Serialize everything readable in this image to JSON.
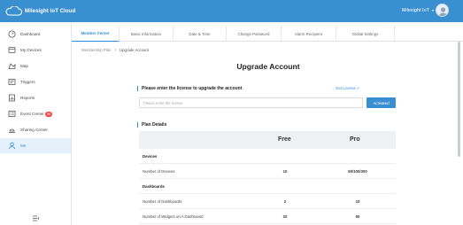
{
  "app": {
    "title": "Milesight IoT Cloud"
  },
  "user": {
    "name": "Milesight IoT"
  },
  "sidebar": {
    "items": [
      {
        "label": "Dashboard",
        "icon": "dashboard-icon"
      },
      {
        "label": "My Devices",
        "icon": "devices-icon"
      },
      {
        "label": "Map",
        "icon": "map-icon"
      },
      {
        "label": "Triggers",
        "icon": "triggers-icon"
      },
      {
        "label": "Reports",
        "icon": "reports-icon"
      },
      {
        "label": "Event Center",
        "icon": "event-center-icon",
        "badge": "99"
      },
      {
        "label": "Sharing Center",
        "icon": "sharing-icon"
      },
      {
        "label": "Me",
        "icon": "user-icon",
        "active": true
      }
    ]
  },
  "tabs": [
    "Member Center",
    "Basic Information",
    "Date & Time",
    "Change Password",
    "Alarm Recipient",
    "Global Settings"
  ],
  "breadcrumb": {
    "parent": "Membership Plan",
    "separator": "/",
    "current": "Upgrade Account"
  },
  "page_title": "Upgrade Account",
  "license": {
    "heading": "Please enter the license to upgrade the account",
    "get_license": "Get License >",
    "placeholder": "Please enter the license",
    "button": "Activated"
  },
  "plan": {
    "heading": "Plan Details",
    "columns": [
      "Free",
      "Pro"
    ],
    "rows": [
      {
        "label": "Devices",
        "section": true,
        "free": "",
        "pro": ""
      },
      {
        "label": "Number of Devices",
        "free": "10",
        "pro": "50/100/300"
      },
      {
        "label": "Dashboards",
        "section": true,
        "free": "",
        "pro": ""
      },
      {
        "label": "Number of Dashboards",
        "free": "2",
        "pro": "10"
      },
      {
        "label": "Number of Widgets on A Dashboard",
        "free": "20",
        "pro": "50"
      }
    ]
  },
  "colors": {
    "brand": "#3a8fd1",
    "accent": "#2f8fdc",
    "badge": "#f04848"
  }
}
